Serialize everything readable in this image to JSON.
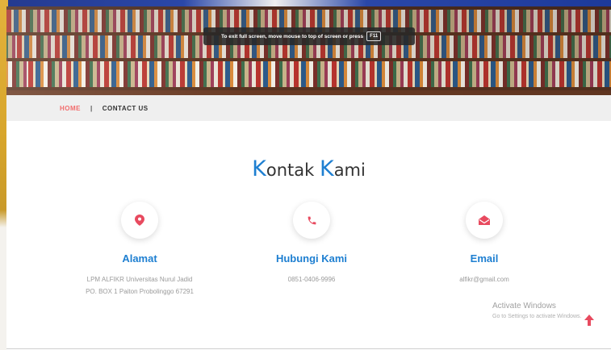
{
  "fullscreen_notice": {
    "text": "To exit full screen, move mouse to top of screen or press",
    "key": "F11"
  },
  "nav": {
    "home": "HOME",
    "separator": "|",
    "contact": "CONTACT US"
  },
  "title": {
    "first_cap": "K",
    "first_rest": "ontak ",
    "second_cap": "K",
    "second_rest": "ami"
  },
  "cards": [
    {
      "icon": "map-pin-icon",
      "title": "Alamat",
      "lines": [
        "LPM ALFIKR Universitas Nurul Jadid",
        "PO. BOX 1 Paiton Probolinggo 67291"
      ]
    },
    {
      "icon": "phone-icon",
      "title": "Hubungi Kami",
      "lines": [
        "0851-0406-9996"
      ]
    },
    {
      "icon": "envelope-icon",
      "title": "Email",
      "lines": [
        "alfikr@gmail.com"
      ]
    }
  ],
  "watermark": {
    "line1": "Activate Windows",
    "line2": "Go to Settings to activate Windows."
  },
  "colors": {
    "accent_blue": "#1e7fd1",
    "accent_red": "#f26b6b",
    "icon_pink": "#e84a5f"
  }
}
